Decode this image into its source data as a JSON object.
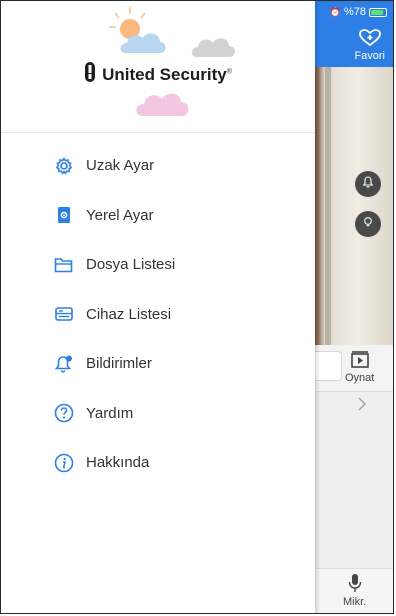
{
  "status_bar": {
    "battery_text": "%78"
  },
  "header": {
    "favorite_label": "Favori"
  },
  "logo": {
    "text": "United Security",
    "reg_mark": "®"
  },
  "menu": [
    {
      "label": "Uzak Ayar",
      "icon": "gear-icon"
    },
    {
      "label": "Yerel Ayar",
      "icon": "phone-settings-icon"
    },
    {
      "label": "Dosya Listesi",
      "icon": "folder-icon"
    },
    {
      "label": "Cihaz Listesi",
      "icon": "device-icon"
    },
    {
      "label": "Bildirimler",
      "icon": "bell-icon"
    },
    {
      "label": "Yardım",
      "icon": "help-icon"
    },
    {
      "label": "Hakkında",
      "icon": "info-icon"
    }
  ],
  "background_app": {
    "play_label": "Oynat",
    "mic_label": "Mikr."
  },
  "colors": {
    "accent": "#2d7fe6",
    "menu_icon": "#2d7fe6"
  }
}
